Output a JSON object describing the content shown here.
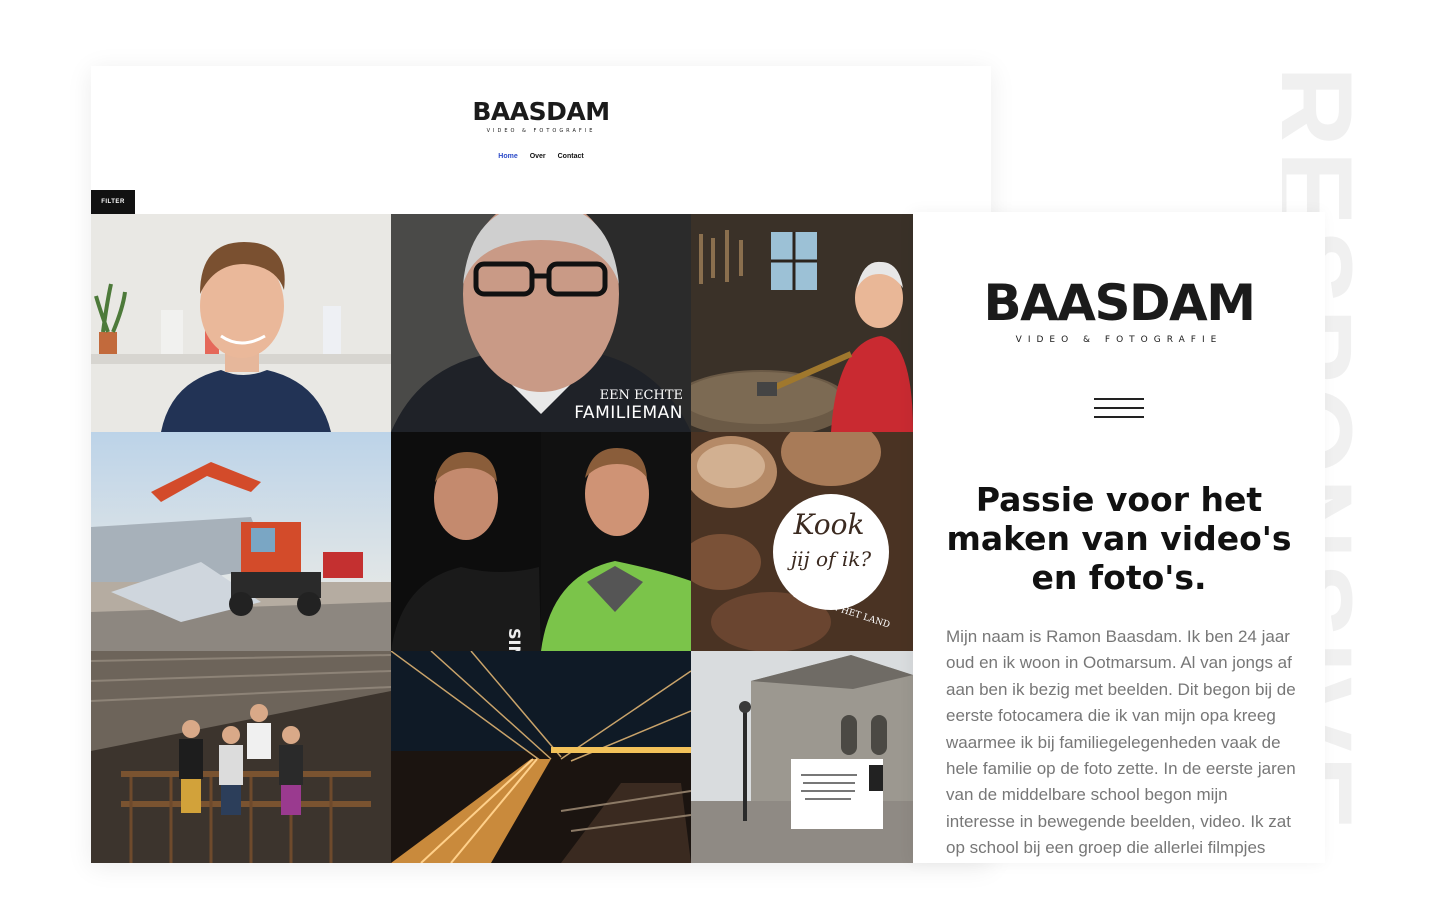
{
  "watermark": "RESPONSIVE",
  "desktop": {
    "logo": {
      "brand": "BAASDAM",
      "tagline": "VIDEO & FOTOGRAFIE"
    },
    "nav": [
      {
        "label": "Home",
        "active": true
      },
      {
        "label": "Over",
        "active": false
      },
      {
        "label": "Contact",
        "active": false
      }
    ],
    "filter_label": "FILTER",
    "portfolio": [
      {
        "name": "portrait-young-man"
      },
      {
        "name": "portrait-older-man",
        "overlay_line1": "EEN ECHTE",
        "overlay_line2": "FAMILIEMAN"
      },
      {
        "name": "workshop-craftsman"
      },
      {
        "name": "excavator-demolition"
      },
      {
        "name": "two-men-portrait",
        "jacket_text": "SINHG"
      },
      {
        "name": "mushrooms",
        "badge_line1": "Kook",
        "badge_line2": "jij of ik?",
        "badge_arc": "VERS VAN HET LAND"
      },
      {
        "name": "band-on-stairs"
      },
      {
        "name": "bridge-night"
      },
      {
        "name": "church-street"
      }
    ]
  },
  "mobile": {
    "logo": {
      "brand": "BAASDAM",
      "tagline": "VIDEO & FOTOGRAFIE"
    },
    "heading": "Passie voor het maken van video's en foto's.",
    "body": "Mijn naam is Ramon Baasdam. Ik ben 24 jaar oud en ik woon in Ootmarsum. Al van jongs af aan ben ik bezig met beelden. Dit begon bij de eerste fotocamera die ik van mijn opa kreeg waarmee ik bij familiegelegenheden vaak de hele familie op de foto zette. In de eerste jaren van de middelbare school begon mijn interesse in bewegende beelden, video. Ik zat op school bij een groep die allerlei filmpjes"
  },
  "colors": {
    "nav_active": "#2b4ac8",
    "filter_bg": "#111111",
    "body_text": "#777777"
  }
}
